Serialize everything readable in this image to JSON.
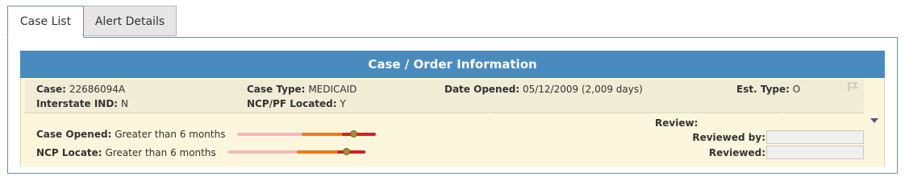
{
  "tabs": [
    {
      "label": "Case List",
      "active": true
    },
    {
      "label": "Alert Details",
      "active": false
    }
  ],
  "panel": {
    "title": "Case / Order Information"
  },
  "case_info": {
    "case_label": "Case:",
    "case_value": "22686094A",
    "case_type_label": "Case Type:",
    "case_type_value": "MEDICAID",
    "date_opened_label": "Date Opened:",
    "date_opened_value": "05/12/2009 (2,009 days)",
    "est_type_label": "Est. Type:",
    "est_type_value": "O",
    "interstate_label": "Interstate IND:",
    "interstate_value": "N",
    "ncp_located_label": "NCP/PF Located:",
    "ncp_located_value": "Y"
  },
  "aging": {
    "case_opened_label": "Case Opened:",
    "case_opened_value": "Greater than 6 months",
    "case_opened_level": 0.84,
    "ncp_locate_label": "NCP Locate:",
    "ncp_locate_value": "Greater than 6 months",
    "ncp_locate_level": 0.86,
    "colors": {
      "low": "#f2b8c0",
      "mid": "#f07a1a",
      "high": "#d81f1f"
    }
  },
  "review": {
    "review_label": "Review:",
    "reviewed_by_label": "Reviewed by:",
    "reviewed_by_value": "",
    "reviewed_label": "Reviewed:",
    "reviewed_value": ""
  },
  "icons": {
    "flag": "flag-icon",
    "expand": "caret-down-icon"
  },
  "colors": {
    "header": "#4a8bbf",
    "body": "#fcf6dc",
    "strip": "#f1ecd6",
    "border": "#6c8fa6"
  }
}
